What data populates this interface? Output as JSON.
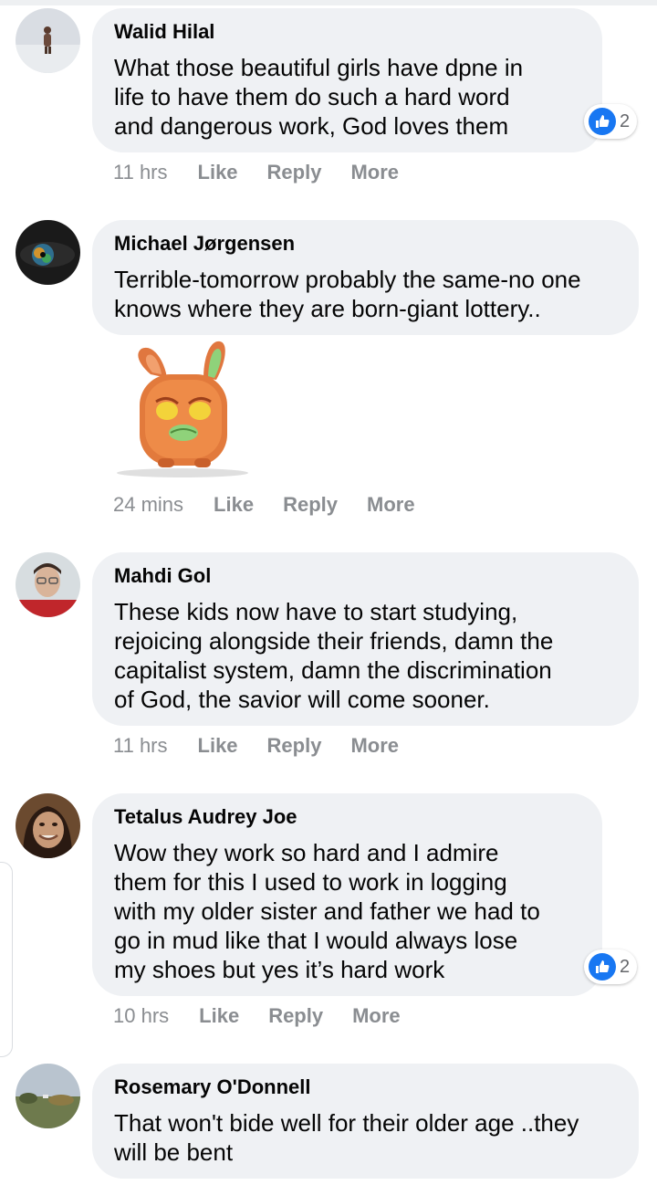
{
  "comments": [
    {
      "author": "Walid Hilal",
      "text_lines": [
        "What those beautiful girls have dpne in",
        "life to have them do such a hard word",
        "and dangerous work, God loves them"
      ],
      "reaction_count": "2",
      "time": "11 hrs"
    },
    {
      "author": "Michael Jørgensen",
      "text_lines": [
        "Terrible-tomorrow probably the same-no one",
        "knows where they are born-giant lottery.."
      ],
      "time": "24 mins"
    },
    {
      "author": "Mahdi Gol",
      "text_lines": [
        "These kids now have to start studying,",
        "rejoicing alongside their friends, damn the",
        "capitalist system, damn the discrimination",
        "of God, the savior will come sooner."
      ],
      "time": "11 hrs"
    },
    {
      "author": "Tetalus Audrey Joe",
      "text_lines": [
        "Wow they work so hard and I admire",
        "them for this I used to work in logging",
        "with my older sister and father we had to",
        "go in mud like that I would always lose",
        "my shoes but yes it’s hard work"
      ],
      "reaction_count": "2",
      "time": "10 hrs"
    },
    {
      "author": "Rosemary O'Donnell",
      "text_lines": [
        "That won't bide well for their older age ..they",
        "will be bent"
      ]
    }
  ],
  "actions": {
    "like": "Like",
    "reply": "Reply",
    "more": "More"
  },
  "colors": {
    "bubble": "#eff1f4",
    "action_text": "#8a8d91",
    "like_blue": "#1877f2"
  },
  "icons": {
    "reaction": "like-thumb-icon",
    "sticker": "sad-bunny-sticker"
  }
}
